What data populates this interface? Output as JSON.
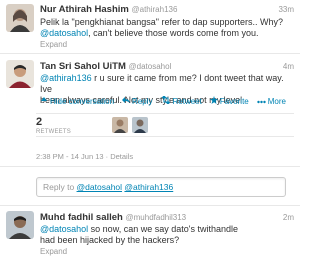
{
  "tweet1": {
    "name": "Nur Athirah Hashim",
    "handle": "@athirah136",
    "time": "33m",
    "line1": "Pelik la \"pengkhianat bangsa\" refer to dap supporters.. Why?",
    "mention": "@datosahol",
    "line2_rest": ", can't believe those words come from you.",
    "expand": "Expand"
  },
  "tweet2": {
    "name": "Tan Sri Sahol UiTM",
    "handle": "@datosahol",
    "time": "4m",
    "mention": "@athirah136",
    "line1_rest": " r u sure it came from me? I dont tweet that way. Ive",
    "line2": "been always careful. Not my style and not my level",
    "actions": {
      "hide": "Hide conversation",
      "reply": "Reply",
      "retweet": "Retweet",
      "favorite": "Favorite",
      "more": "More"
    },
    "retweets_count": "2",
    "retweets_label": "RETWEETS",
    "dateline": "2:38 PM - 14 Jun 13 · Details"
  },
  "reply_box": {
    "prefix": "Reply to ",
    "mention1": "@datosahol",
    "mention2": "@athirah136"
  },
  "tweet3": {
    "name": "Muhd fadhil salleh",
    "handle": "@muhdfadhil313",
    "time": "2m",
    "mention": "@datosahol",
    "line1_rest": " so now, can we say dato's twithandle",
    "line2": "had been hijacked by the hackers?",
    "expand": "Expand"
  },
  "colors": {
    "link": "#0084b4",
    "muted": "#999999",
    "text": "#333333"
  }
}
